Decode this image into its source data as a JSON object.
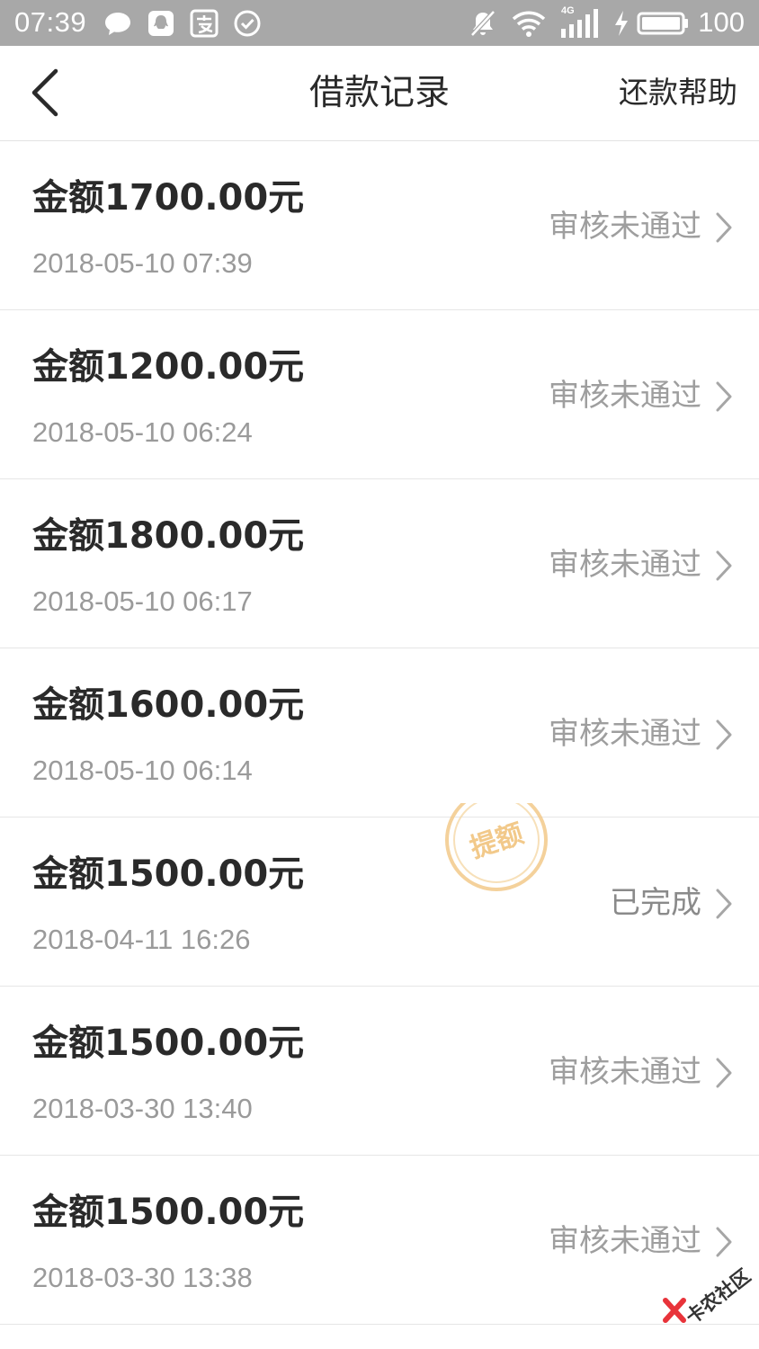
{
  "status_bar": {
    "time": "07:39",
    "battery_level": "100",
    "network_label": "4G",
    "icons": [
      "chat-bubble-icon",
      "qq-icon",
      "alipay-icon",
      "check-circle-icon",
      "mute-bell-icon",
      "wifi-icon",
      "signal-icon",
      "charging-icon",
      "battery-icon"
    ]
  },
  "header": {
    "title": "借款记录",
    "help_label": "还款帮助",
    "back_icon": "chevron-left-icon"
  },
  "records": [
    {
      "amount": "金额1700.00元",
      "date": "2018-05-10 07:39",
      "status": "审核未通过"
    },
    {
      "amount": "金额1200.00元",
      "date": "2018-05-10 06:24",
      "status": "审核未通过"
    },
    {
      "amount": "金额1800.00元",
      "date": "2018-05-10 06:17",
      "status": "审核未通过"
    },
    {
      "amount": "金额1600.00元",
      "date": "2018-05-10 06:14",
      "status": "审核未通过"
    },
    {
      "amount": "金额1500.00元",
      "date": "2018-04-11 16:26",
      "status": "已完成"
    },
    {
      "amount": "金额1500.00元",
      "date": "2018-03-30 13:40",
      "status": "审核未通过"
    },
    {
      "amount": "金额1500.00元",
      "date": "2018-03-30 13:38",
      "status": "审核未通过"
    }
  ],
  "stamp": {
    "text": "提额",
    "color": "#f2c98a"
  },
  "watermark": {
    "text": "卡农社区",
    "accent_color": "#e8333a"
  },
  "colors": {
    "status_bar_bg": "#a8a8a8",
    "primary_text": "#2a2a2a",
    "secondary_text": "#9a9a9a",
    "divider": "#e6e6e6"
  }
}
